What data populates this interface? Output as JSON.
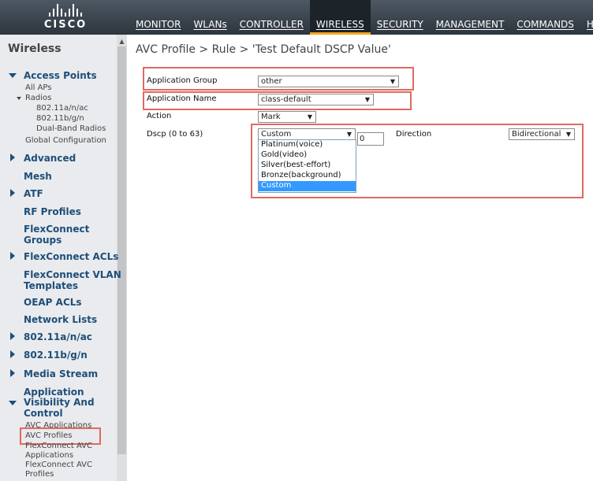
{
  "brand": {
    "logo_text": "CISCO"
  },
  "nav": [
    {
      "label": "MONITOR"
    },
    {
      "label": "WLANs"
    },
    {
      "label": "CONTROLLER"
    },
    {
      "label": "WIRELESS"
    },
    {
      "label": "SECURITY"
    },
    {
      "label": "MANAGEMENT"
    },
    {
      "label": "COMMANDS"
    },
    {
      "label": "HELP"
    }
  ],
  "sidebar": {
    "title": "Wireless",
    "access_points": {
      "label": "Access Points",
      "all_aps": "All APs",
      "radios": "Radios",
      "radio_a": "802.11a/n/ac",
      "radio_b": "802.11b/g/n",
      "dual_band": "Dual-Band Radios",
      "global_config": "Global Configuration"
    },
    "advanced": "Advanced",
    "mesh": "Mesh",
    "atf": "ATF",
    "rf_profiles": "RF Profiles",
    "flexconnect_groups": [
      "FlexConnect",
      "Groups"
    ],
    "flexconnect_acls": "FlexConnect ACLs",
    "flexconnect_vlan": [
      "FlexConnect VLAN",
      "Templates"
    ],
    "oeap_acls": "OEAP ACLs",
    "network_lists": "Network Lists",
    "band_a": "802.11a/n/ac",
    "band_b": "802.11b/g/n",
    "media_stream": "Media Stream",
    "avc": {
      "label": [
        "Application",
        "Visibility And",
        "Control"
      ],
      "applications": "AVC Applications",
      "profiles": "AVC Profiles",
      "fc_applications": [
        "FlexConnect AVC",
        "Applications"
      ],
      "fc_profiles": [
        "FlexConnect AVC",
        "Profiles"
      ]
    }
  },
  "main": {
    "title": "AVC Profile > Rule > 'Test Default DSCP Value'",
    "application_group": {
      "label": "Application Group",
      "value": "other"
    },
    "application_name": {
      "label": "Application Name",
      "value": "class-default"
    },
    "action": {
      "label": "Action",
      "value": "Mark"
    },
    "dscp": {
      "label": "Dscp (0 to 63)",
      "value": "Custom",
      "input_value": "0",
      "options": [
        "Platinum(voice)",
        "Gold(video)",
        "Silver(best-effort)",
        "Bronze(background)",
        "Custom"
      ],
      "selected_option": "Custom"
    },
    "direction": {
      "label": "Direction",
      "value": "Bidirectional"
    }
  },
  "colors": {
    "header": "#3a444e",
    "nav_active": "#1c2329",
    "nav_underline": "#f5a623",
    "highlight": "#e06a5e",
    "section_text": "#1f4e79",
    "selected_option": "#3399ff"
  },
  "glyphs": {
    "dropdown_arrow": "▼",
    "scroll_up": "▲"
  }
}
